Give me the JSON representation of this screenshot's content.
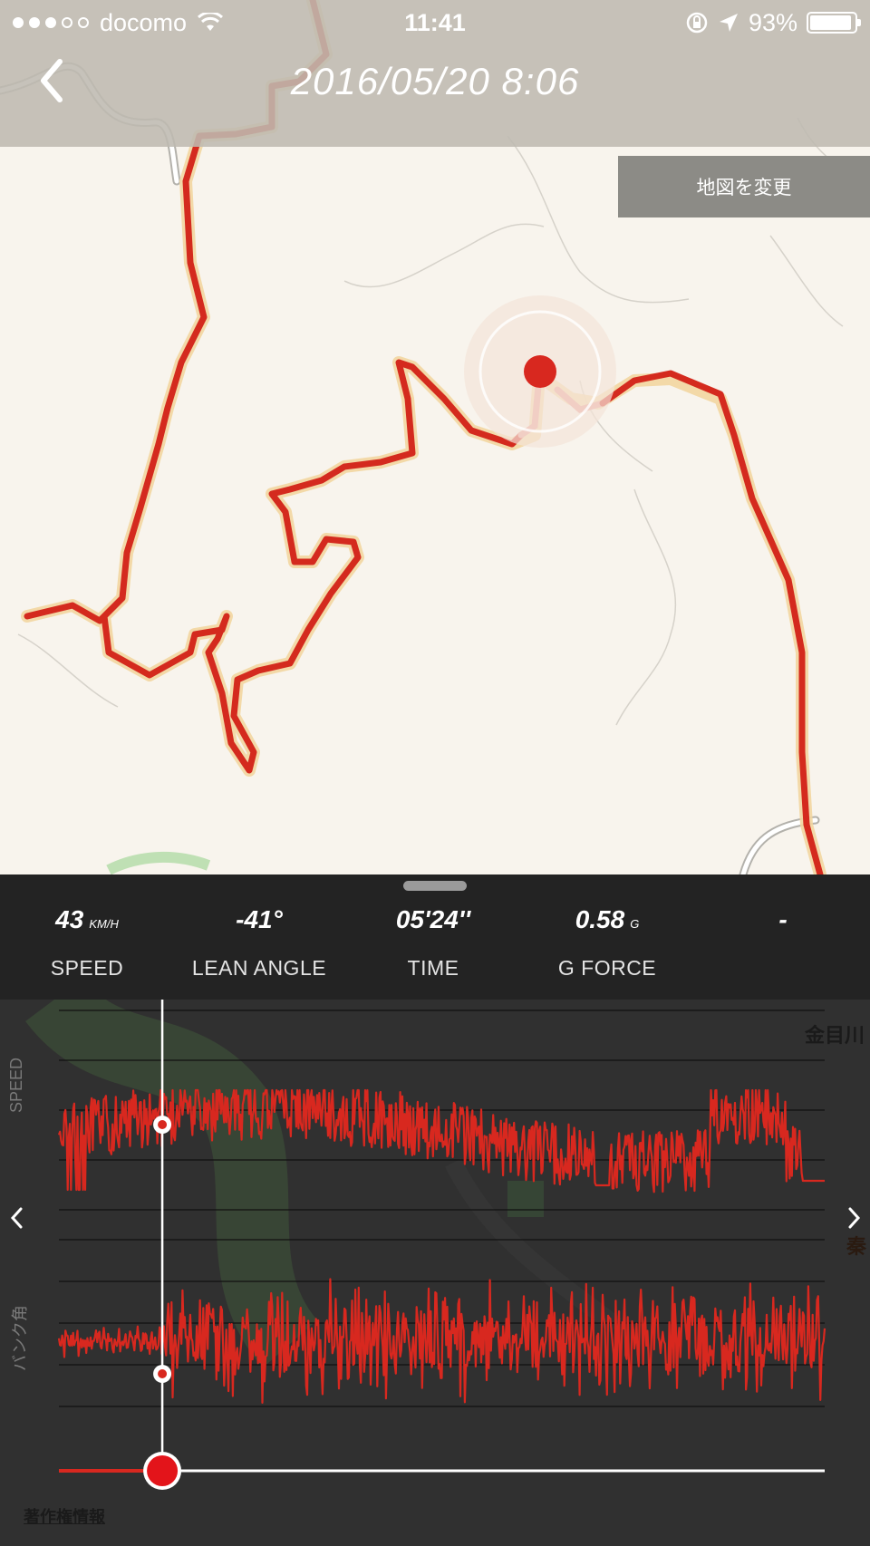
{
  "status_bar": {
    "carrier": "docomo",
    "time": "11:41",
    "battery": "93%",
    "battery_level": 0.93
  },
  "header": {
    "title": "2016/05/20 8:06"
  },
  "map": {
    "change_map_label": "地図を変更",
    "labels": {
      "river": "金目川",
      "partial": "秦"
    },
    "copyright": "著作権情報"
  },
  "stats": [
    {
      "value": "43",
      "unit": "KM/H",
      "label": "SPEED"
    },
    {
      "value": "-41°",
      "unit": "",
      "label": "LEAN ANGLE"
    },
    {
      "value": "05'24''",
      "unit": "",
      "label": "TIME"
    },
    {
      "value": "0.58",
      "unit": "G",
      "label": "G FORCE"
    },
    {
      "value": "-",
      "unit": "",
      "label": ""
    }
  ],
  "graph": {
    "speed_label": "SPEED",
    "lean_label": "バンク角",
    "playback_position": 0.135
  },
  "colors": {
    "accent": "#d8281f",
    "route": "#d42a1e"
  }
}
